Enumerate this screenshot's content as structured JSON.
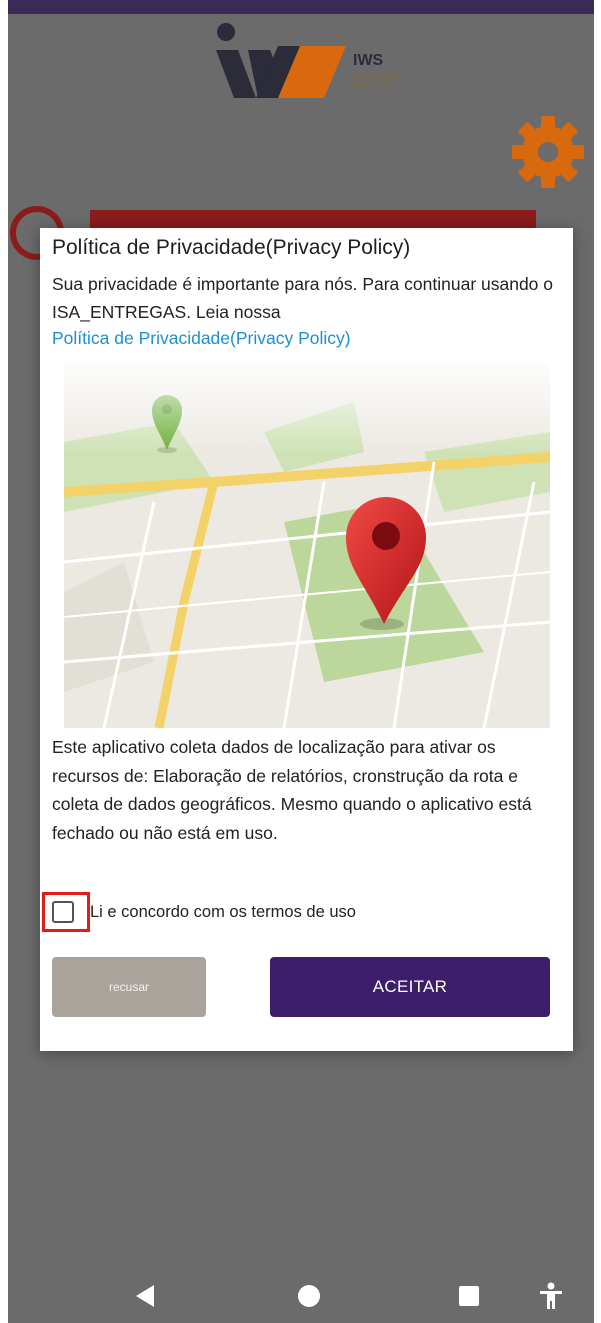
{
  "app": {
    "logo_text": "IWS",
    "logo_subtitle": "INTELLIWARE SOLUTIONS"
  },
  "dialog": {
    "title": "Política de Privacidade(Privacy Policy)",
    "intro": "Sua privacidade é importante para nós. Para continuar usando o ISA_ENTREGAS. Leia nossa",
    "link_text": "Política de Privacidade(Privacy Policy)",
    "description": "Este aplicativo coleta dados de localização para ativar os recursos de: Elaboração de relatórios, cronstrução da rota e coleta de dados geográficos. Mesmo quando o aplicativo está fechado ou não está em uso.",
    "terms_label": "Li e concordo com os termos de uso",
    "terms_checked": false,
    "refuse_label": "recusar",
    "accept_label": "ACEITAR"
  },
  "colors": {
    "accent": "#3e1d6b",
    "link": "#1e8fd1",
    "gear": "#d8690f",
    "highlight": "#e41b1b"
  },
  "icons": {
    "settings": "gear-icon",
    "back": "back-triangle-icon",
    "home": "home-circle-icon",
    "recents": "recents-square-icon",
    "accessibility": "accessibility-icon"
  }
}
